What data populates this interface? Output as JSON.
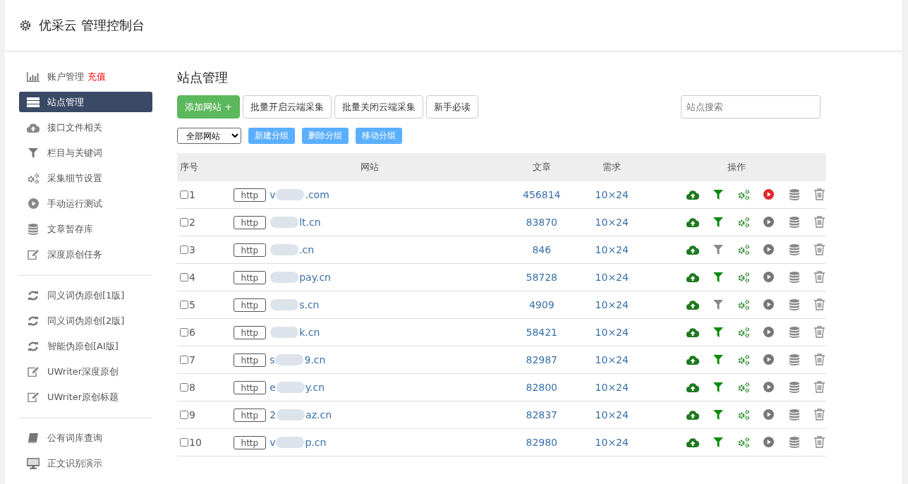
{
  "header": {
    "title": "优采云 管理控制台"
  },
  "sidebar": {
    "groups": [
      {
        "items": [
          {
            "label": "账户管理",
            "badge": "充值",
            "selected": false
          },
          {
            "label": "站点管理",
            "selected": true
          },
          {
            "label": "接口文件相关",
            "selected": false
          },
          {
            "label": "栏目与关键词",
            "selected": false
          },
          {
            "label": "采集细节设置",
            "selected": false
          },
          {
            "label": "手动运行测试",
            "selected": false
          },
          {
            "label": "文章暂存库",
            "selected": false
          },
          {
            "label": "深度原创任务",
            "selected": false
          }
        ]
      },
      {
        "items": [
          {
            "label": "同义词伪原创[1版]",
            "selected": false
          },
          {
            "label": "同义词伪原创[2版]",
            "selected": false
          },
          {
            "label": "智能伪原创[AI版]",
            "selected": false
          },
          {
            "label": "UWriter深度原创",
            "selected": false
          },
          {
            "label": "UWriter原创标题",
            "selected": false
          }
        ]
      },
      {
        "items": [
          {
            "label": "公有词库查询",
            "selected": false
          },
          {
            "label": "正文识别演示",
            "selected": false
          }
        ]
      }
    ]
  },
  "main": {
    "title": "站点管理",
    "toolbar": [
      {
        "label": "添加网站 +",
        "kind": "primary"
      },
      {
        "label": "批量开启云端采集",
        "kind": "default"
      },
      {
        "label": "批量关闭云端采集",
        "kind": "default"
      },
      {
        "label": "新手必读",
        "kind": "default"
      }
    ],
    "search": {
      "placeholder": "站点搜索"
    },
    "group_select": {
      "value": "全部网站"
    },
    "group_buttons": [
      "新建分组",
      "删除分组",
      "移动分组"
    ],
    "table": {
      "columns": [
        "序号",
        "网站",
        "文章",
        "需求",
        "操作"
      ],
      "rows": [
        {
          "checked": false,
          "index": "1",
          "scheme": "http",
          "site_start": "v",
          "site_end": ".com",
          "articles": "456814",
          "demand": "10×24",
          "filter_on": true,
          "running": true
        },
        {
          "checked": false,
          "index": "2",
          "scheme": "http",
          "site_start": "",
          "site_end": "lt.cn",
          "articles": "83870",
          "demand": "10×24",
          "filter_on": true,
          "running": false
        },
        {
          "checked": false,
          "index": "3",
          "scheme": "http",
          "site_start": "",
          "site_end": ".cn",
          "articles": "846",
          "demand": "10×24",
          "filter_on": false,
          "running": false
        },
        {
          "checked": false,
          "index": "4",
          "scheme": "http",
          "site_start": "",
          "site_end": "pay.cn",
          "articles": "58728",
          "demand": "10×24",
          "filter_on": true,
          "running": false
        },
        {
          "checked": false,
          "index": "5",
          "scheme": "http",
          "site_start": "",
          "site_end": "s.cn",
          "articles": "4909",
          "demand": "10×24",
          "filter_on": false,
          "running": false
        },
        {
          "checked": false,
          "index": "6",
          "scheme": "http",
          "site_start": "",
          "site_end": "k.cn",
          "articles": "58421",
          "demand": "10×24",
          "filter_on": true,
          "running": false
        },
        {
          "checked": false,
          "index": "7",
          "scheme": "http",
          "site_start": "s",
          "site_end": "9.cn",
          "articles": "82987",
          "demand": "10×24",
          "filter_on": true,
          "running": false
        },
        {
          "checked": false,
          "index": "8",
          "scheme": "http",
          "site_start": "e",
          "site_end": "y.cn",
          "articles": "82800",
          "demand": "10×24",
          "filter_on": true,
          "running": false
        },
        {
          "checked": false,
          "index": "9",
          "scheme": "http",
          "site_start": "2",
          "site_end": "az.cn",
          "articles": "82837",
          "demand": "10×24",
          "filter_on": true,
          "running": false
        },
        {
          "checked": false,
          "index": "10",
          "scheme": "http",
          "site_start": "v",
          "site_end": "p.cn",
          "articles": "82980",
          "demand": "10×24",
          "filter_on": true,
          "running": false
        }
      ]
    }
  }
}
